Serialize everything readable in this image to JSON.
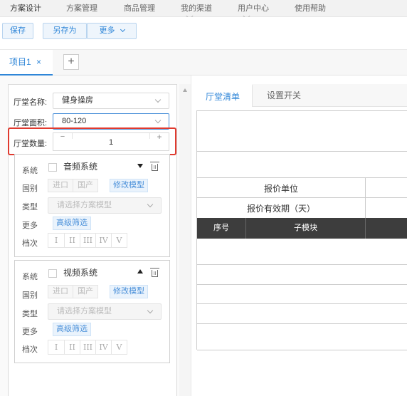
{
  "top_menu": {
    "items": [
      "方案设计",
      "方案管理",
      "商品管理",
      "我的渠道",
      "用户中心",
      "使用帮助"
    ],
    "active": "方案设计"
  },
  "toolbar": {
    "save_label": "保存",
    "save_as_label": "另存为",
    "more_label": "更多"
  },
  "project_tabs": {
    "tabs": [
      {
        "label": "项目1"
      }
    ],
    "close_symbol": "×",
    "add_symbol": "+"
  },
  "hall": {
    "name_label": "厅堂名称:",
    "name_value": "健身操房",
    "area_label": "厅堂面积:",
    "area_value": "80-120",
    "count_label": "厅堂数量:",
    "count_value": "1",
    "minus_symbol": "−",
    "plus_symbol": "+"
  },
  "systems": [
    {
      "system_label": "系统",
      "system_name": "音频系统",
      "expanded": true,
      "origin_label": "国别",
      "origin_options": [
        "进口",
        "国产"
      ],
      "modify_model_label": "修改模型",
      "type_label": "类型",
      "type_placeholder": "请选择方案模型",
      "more_label": "更多",
      "advanced_filter_label": "高级筛选",
      "grade_label": "档次",
      "grades": [
        "I",
        "II",
        "III",
        "IV",
        "V"
      ]
    },
    {
      "system_label": "系统",
      "system_name": "视频系统",
      "expanded": false,
      "origin_label": "国别",
      "origin_options": [
        "进口",
        "国产"
      ],
      "modify_model_label": "修改模型",
      "type_label": "类型",
      "type_placeholder": "请选择方案模型",
      "more_label": "更多",
      "advanced_filter_label": "高级筛选",
      "grade_label": "档次",
      "grades": [
        "I",
        "II",
        "III",
        "IV",
        "V"
      ]
    }
  ],
  "right": {
    "tabs": [
      "厅堂清单",
      "设置开关"
    ],
    "active_tab": "厅堂清单",
    "quote_unit_label": "报价单位",
    "quote_validity_label": "报价有效期（天）",
    "table_headers": [
      "序号",
      "子模块"
    ]
  },
  "colors": {
    "accent": "#2f86d8",
    "highlight_border": "#e03a2f",
    "table_header_bg": "#3d3d3d"
  }
}
